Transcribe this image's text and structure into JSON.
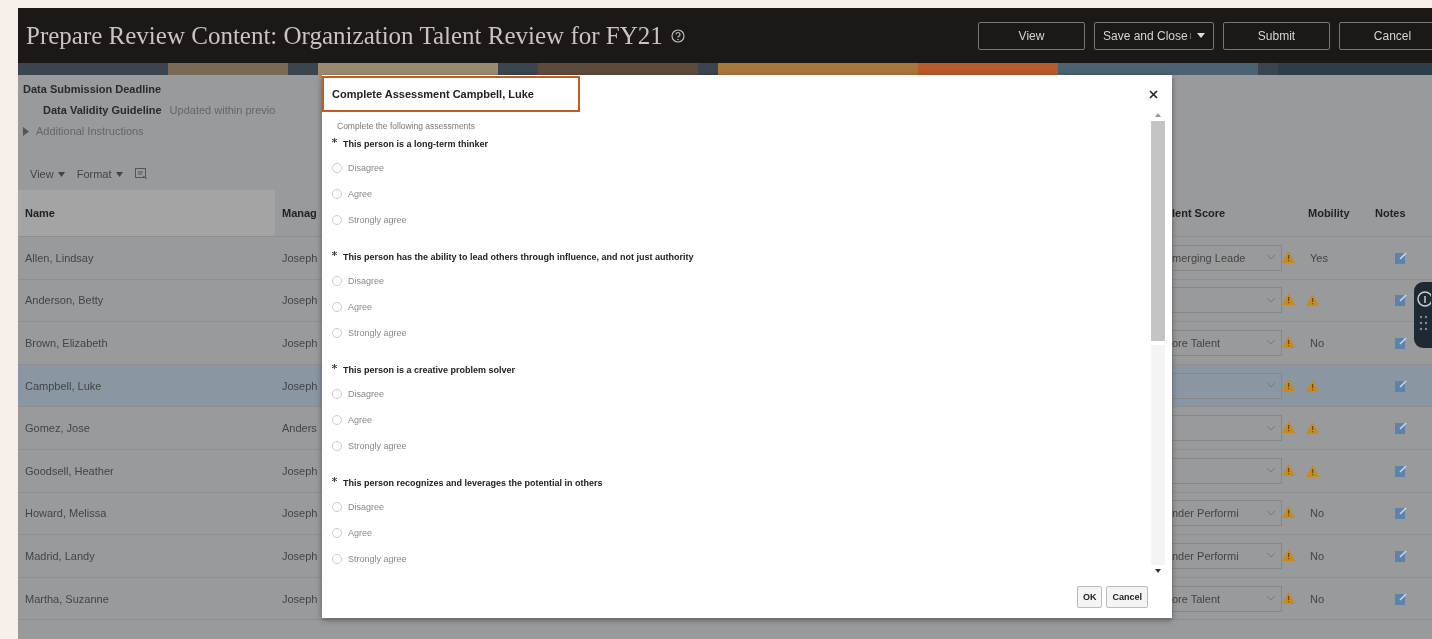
{
  "header": {
    "title": "Prepare Review Content: Organization Talent Review for FY21",
    "buttons": [
      {
        "label": "View",
        "kind": "plain"
      },
      {
        "label": "Save and Close",
        "kind": "split"
      },
      {
        "label": "Submit",
        "kind": "plain"
      },
      {
        "label": "Cancel",
        "kind": "plain"
      }
    ]
  },
  "info": {
    "deadline_label": "Data Submission Deadline",
    "guideline_label": "Data Validity Guideline",
    "guideline_value": "Updated within previo",
    "instructions": "Additional Instructions",
    "instructions_expanded": false
  },
  "toolbar": [
    {
      "label": "View"
    },
    {
      "label": "Format"
    }
  ],
  "table": {
    "columns": [
      "Name",
      "Manag",
      "lent Score",
      "Mobility",
      "Notes"
    ],
    "rows": [
      {
        "name": "Allen, Lindsay",
        "manager": "Joseph",
        "talent_score": "merging Leade",
        "score_warning": true,
        "mobility": "Yes",
        "mobility_warning": false,
        "selected": false
      },
      {
        "name": "Anderson, Betty",
        "manager": "Joseph",
        "talent_score": "",
        "score_warning": true,
        "mobility": "",
        "mobility_warning": true,
        "selected": false
      },
      {
        "name": "Brown, Elizabeth",
        "manager": "Joseph",
        "talent_score": "ore Talent",
        "score_warning": true,
        "mobility": "No",
        "mobility_warning": false,
        "selected": false
      },
      {
        "name": "Campbell, Luke",
        "manager": "Joseph",
        "talent_score": "",
        "score_warning": true,
        "mobility": "",
        "mobility_warning": true,
        "selected": true
      },
      {
        "name": "Gomez, Jose",
        "manager": "Anders",
        "talent_score": "",
        "score_warning": true,
        "mobility": "",
        "mobility_warning": true,
        "selected": false
      },
      {
        "name": "Goodsell, Heather",
        "manager": "Joseph",
        "talent_score": "",
        "score_warning": true,
        "mobility": "",
        "mobility_warning": true,
        "selected": false
      },
      {
        "name": "Howard, Melissa",
        "manager": "Joseph",
        "talent_score": "nder Performi",
        "score_warning": true,
        "mobility": "No",
        "mobility_warning": false,
        "selected": false
      },
      {
        "name": "Madrid, Landy",
        "manager": "Joseph",
        "talent_score": "nder Performi",
        "score_warning": true,
        "mobility": "No",
        "mobility_warning": false,
        "selected": false
      },
      {
        "name": "Martha, Suzanne",
        "manager": "Joseph",
        "talent_score": "ore Talent",
        "score_warning": true,
        "mobility": "No",
        "mobility_warning": false,
        "selected": false
      }
    ]
  },
  "dialog": {
    "title": "Complete Assessment Campbell, Luke",
    "subtitle": "Complete the following assessments",
    "questions": [
      {
        "text": "This person is a long-term thinker",
        "required": true,
        "options": [
          {
            "label": "Disagree",
            "selected": false
          },
          {
            "label": "Agree",
            "selected": false
          },
          {
            "label": "Strongly agree",
            "selected": false
          }
        ]
      },
      {
        "text": "This person has the ability to lead others through influence, and not just authority",
        "required": true,
        "options": [
          {
            "label": "Disagree",
            "selected": false
          },
          {
            "label": "Agree",
            "selected": false
          },
          {
            "label": "Strongly agree",
            "selected": false
          }
        ]
      },
      {
        "text": "This person is a creative problem solver",
        "required": true,
        "options": [
          {
            "label": "Disagree",
            "selected": false
          },
          {
            "label": "Agree",
            "selected": false
          },
          {
            "label": "Strongly agree",
            "selected": false
          }
        ]
      },
      {
        "text": "This person recognizes and leverages the potential in others",
        "required": true,
        "options": [
          {
            "label": "Disagree",
            "selected": false
          },
          {
            "label": "Agree",
            "selected": false
          },
          {
            "label": "Strongly agree",
            "selected": false
          }
        ]
      }
    ],
    "buttons": [
      "OK",
      "Cancel"
    ]
  }
}
